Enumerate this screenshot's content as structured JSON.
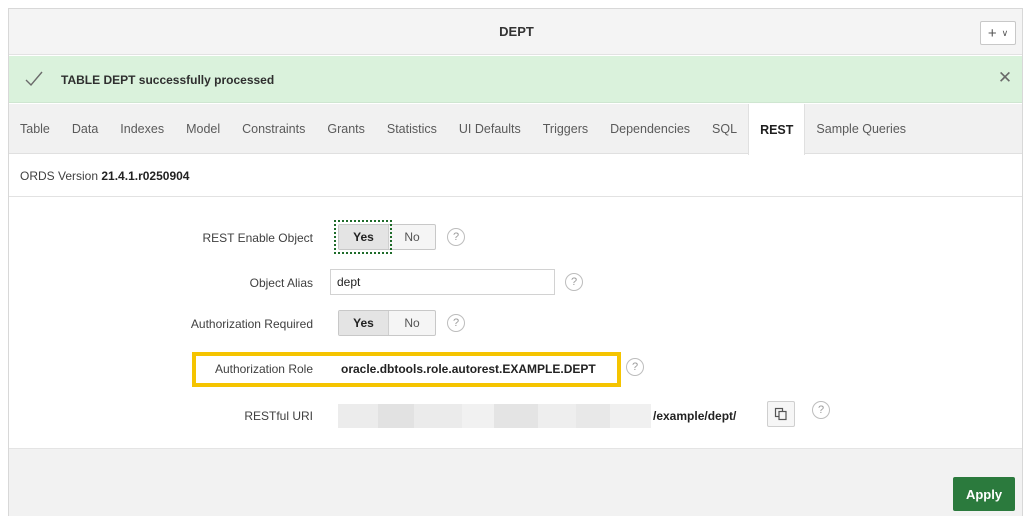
{
  "header": {
    "title": "DEPT",
    "add_icon": "plus-icon",
    "menu_icon": "chevron-down-icon"
  },
  "banner": {
    "message": "TABLE DEPT successfully processed",
    "icon": "check-icon",
    "close_icon": "close-icon",
    "color": "#daf2dc"
  },
  "tabs": [
    {
      "label": "Table"
    },
    {
      "label": "Data"
    },
    {
      "label": "Indexes"
    },
    {
      "label": "Model"
    },
    {
      "label": "Constraints"
    },
    {
      "label": "Grants"
    },
    {
      "label": "Statistics"
    },
    {
      "label": "UI Defaults"
    },
    {
      "label": "Triggers"
    },
    {
      "label": "Dependencies"
    },
    {
      "label": "SQL"
    },
    {
      "label": "REST",
      "active": true
    },
    {
      "label": "Sample Queries"
    }
  ],
  "ords": {
    "prefix": "ORDS Version",
    "version": "21.4.1.r0250904"
  },
  "form": {
    "rest_enable": {
      "label": "REST Enable Object",
      "yes": "Yes",
      "no": "No",
      "value": "Yes"
    },
    "object_alias": {
      "label": "Object Alias",
      "value": "dept"
    },
    "auth_required": {
      "label": "Authorization Required",
      "yes": "Yes",
      "no": "No",
      "value": "Yes"
    },
    "auth_role": {
      "label": "Authorization Role",
      "value": "oracle.dbtools.role.autorest.EXAMPLE.DEPT"
    },
    "restful_uri": {
      "label": "RESTful URI",
      "suffix": "/example/dept/",
      "copy_icon": "copy-icon"
    },
    "help_icon": "help-icon",
    "help_glyph": "?"
  },
  "footer": {
    "apply_label": "Apply"
  },
  "colors": {
    "accent": "#2b7a3d",
    "highlight": "#f5c400",
    "banner": "#daf2dc"
  }
}
